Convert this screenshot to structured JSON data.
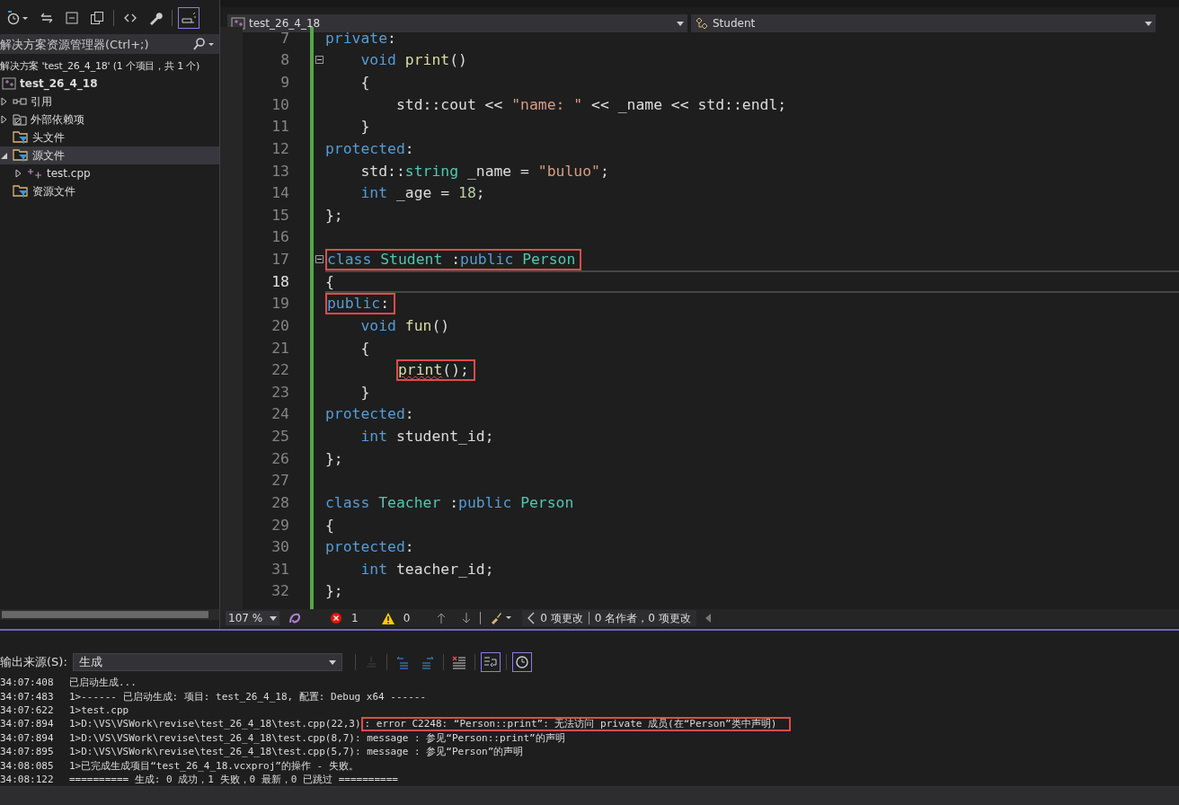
{
  "solution_explorer": {
    "toolbar": [
      {
        "kind": "history",
        "selected": false
      },
      {
        "kind": "sync",
        "selected": false
      },
      {
        "kind": "collapse",
        "selected": false
      },
      {
        "kind": "copy",
        "selected": false
      },
      {
        "kind": "code",
        "selected": false
      },
      {
        "kind": "properties",
        "selected": false
      },
      {
        "kind": "preview",
        "selected": true
      }
    ],
    "search_placeholder": "解决方案资源管理器(Ctrl+;)",
    "tree": [
      {
        "label": "解决方案 'test_26_4_18' (1 个项目，共 1 个)",
        "kind": "solution",
        "selected": false,
        "children": [
          {
            "label": "test_26_4_18",
            "kind": "project",
            "selected": false,
            "children": [
              {
                "label": "引用",
                "kind": "reference",
                "expanded": false,
                "selected": false
              },
              {
                "label": "外部依赖项",
                "kind": "external",
                "expanded": false,
                "selected": false
              },
              {
                "label": "头文件",
                "kind": "filter",
                "selected": false
              },
              {
                "label": "源文件",
                "kind": "filter",
                "expanded": true,
                "selected": true,
                "children": [
                  {
                    "label": "test.cpp",
                    "kind": "file",
                    "expanded": false,
                    "selected": false
                  }
                ]
              },
              {
                "label": "资源文件",
                "kind": "filter",
                "selected": false
              }
            ]
          }
        ]
      }
    ]
  },
  "editor": {
    "project_dropdown": "test_26_4_18",
    "scope_dropdown": "Student",
    "lines": [
      {
        "number": "7",
        "tokens": [
          {
            "text": "private",
            "kind": "keyword"
          },
          {
            "text": ":",
            "kind": "plain"
          }
        ]
      },
      {
        "number": "8",
        "foldable": true,
        "tokens": [
          {
            "text": "    void",
            "kind": "keyword"
          },
          {
            "text": " print",
            "kind": "function"
          },
          {
            "text": "()",
            "kind": "plain"
          }
        ]
      },
      {
        "number": "9",
        "tokens": [
          {
            "text": "    {",
            "kind": "plain"
          }
        ]
      },
      {
        "number": "10",
        "tokens": [
          {
            "text": "        std::cout << ",
            "kind": "plain"
          },
          {
            "text": "\"name: \"",
            "kind": "string"
          },
          {
            "text": " << _name << std::endl;",
            "kind": "plain"
          }
        ]
      },
      {
        "number": "11",
        "tokens": [
          {
            "text": "    }",
            "kind": "plain"
          }
        ]
      },
      {
        "number": "12",
        "tokens": [
          {
            "text": "protected",
            "kind": "keyword"
          },
          {
            "text": ":",
            "kind": "plain"
          }
        ]
      },
      {
        "number": "13",
        "tokens": [
          {
            "text": "    std::",
            "kind": "plain"
          },
          {
            "text": "string",
            "kind": "type"
          },
          {
            "text": " _name = ",
            "kind": "plain"
          },
          {
            "text": "\"buluo\"",
            "kind": "string"
          },
          {
            "text": ";",
            "kind": "plain"
          }
        ]
      },
      {
        "number": "14",
        "tokens": [
          {
            "text": "    int",
            "kind": "keyword"
          },
          {
            "text": " _age = ",
            "kind": "plain"
          },
          {
            "text": "18",
            "kind": "number"
          },
          {
            "text": ";",
            "kind": "plain"
          }
        ]
      },
      {
        "number": "15",
        "tokens": [
          {
            "text": "};",
            "kind": "plain"
          }
        ]
      },
      {
        "number": "16"
      },
      {
        "number": "17",
        "foldable": true,
        "tokens": [
          {
            "text": "class",
            "kind": "keyword",
            "boxed": true
          },
          {
            "text": " Student",
            "kind": "type",
            "boxed": true
          },
          {
            "text": " :",
            "kind": "plain",
            "boxed": true
          },
          {
            "text": "public",
            "kind": "keyword",
            "boxed": true
          },
          {
            "text": " Person",
            "kind": "type",
            "boxed": true
          }
        ]
      },
      {
        "number": "18",
        "current": true,
        "tokens": [
          {
            "text": "{",
            "kind": "plain"
          }
        ]
      },
      {
        "number": "19",
        "tokens": [
          {
            "text": "public",
            "kind": "keyword",
            "boxed": true
          },
          {
            "text": ":",
            "kind": "plain",
            "boxed": true
          }
        ]
      },
      {
        "number": "20",
        "tokens": [
          {
            "text": "    void",
            "kind": "keyword"
          },
          {
            "text": " fun",
            "kind": "function"
          },
          {
            "text": "()",
            "kind": "plain"
          }
        ]
      },
      {
        "number": "21",
        "tokens": [
          {
            "text": "    {",
            "kind": "plain"
          }
        ]
      },
      {
        "number": "22",
        "tokens": [
          {
            "text": "        print",
            "kind": "function",
            "boxed": true,
            "error": true
          },
          {
            "text": "();",
            "kind": "plain",
            "boxed": true
          }
        ]
      },
      {
        "number": "23",
        "tokens": [
          {
            "text": "    }",
            "kind": "plain"
          }
        ]
      },
      {
        "number": "24",
        "tokens": [
          {
            "text": "protected",
            "kind": "keyword"
          },
          {
            "text": ":",
            "kind": "plain"
          }
        ]
      },
      {
        "number": "25",
        "tokens": [
          {
            "text": "    int",
            "kind": "keyword"
          },
          {
            "text": " student_id;",
            "kind": "plain"
          }
        ]
      },
      {
        "number": "26",
        "tokens": [
          {
            "text": "};",
            "kind": "plain"
          }
        ]
      },
      {
        "number": "27"
      },
      {
        "number": "28",
        "tokens": [
          {
            "text": "class",
            "kind": "keyword"
          },
          {
            "text": " Teacher",
            "kind": "type"
          },
          {
            "text": " :",
            "kind": "plain"
          },
          {
            "text": "public",
            "kind": "keyword"
          },
          {
            "text": " Person",
            "kind": "type"
          }
        ]
      },
      {
        "number": "29",
        "tokens": [
          {
            "text": "{",
            "kind": "plain"
          }
        ]
      },
      {
        "number": "30",
        "tokens": [
          {
            "text": "protected",
            "kind": "keyword"
          },
          {
            "text": ":",
            "kind": "plain"
          }
        ]
      },
      {
        "number": "31",
        "tokens": [
          {
            "text": "    int",
            "kind": "keyword"
          },
          {
            "text": " teacher_id;",
            "kind": "plain"
          }
        ]
      },
      {
        "number": "32",
        "tokens": [
          {
            "text": "};",
            "kind": "plain"
          }
        ]
      }
    ],
    "status": {
      "zoom": "107 %",
      "errors": "1",
      "warnings": "0",
      "changes": "0 项更改",
      "authors": "0 名作者，0 项更改"
    }
  },
  "output": {
    "source_label": "输出来源(S):",
    "source_value": "生成",
    "toolbar": [
      {
        "kind": "goto",
        "disabled": true,
        "selected": false
      },
      {
        "kind": "previous",
        "disabled": false,
        "selected": false
      },
      {
        "kind": "next",
        "disabled": false,
        "selected": false
      },
      {
        "kind": "clear",
        "disabled": false,
        "selected": false
      },
      {
        "kind": "wrap",
        "disabled": false,
        "selected": true
      },
      {
        "kind": "timestamp",
        "disabled": false,
        "selected": true
      }
    ],
    "lines": [
      {
        "time": "34:07:408",
        "text": "已启动生成..."
      },
      {
        "time": "34:07:483",
        "text": "1>------ 已启动生成: 项目: test_26_4_18, 配置: Debug x64 ------"
      },
      {
        "time": "34:07:622",
        "text": "1>test.cpp"
      },
      {
        "time": "34:07:894",
        "text": "1>D:\\VS\\VSWork\\revise\\test_26_4_18\\test.cpp(22,3)",
        "boxed_text": ": error C2248: “Person::print”: 无法访问 private 成员(在“Person”类中声明)"
      },
      {
        "time": "34:07:894",
        "text": "1>D:\\VS\\VSWork\\revise\\test_26_4_18\\test.cpp(8,7): message : 参见“Person::print”的声明"
      },
      {
        "time": "34:07:895",
        "text": "1>D:\\VS\\VSWork\\revise\\test_26_4_18\\test.cpp(5,7): message : 参见“Person”的声明"
      },
      {
        "time": "34:08:085",
        "text": "1>已完成生成项目“test_26_4_18.vcxproj”的操作 - 失败。"
      },
      {
        "time": "34:08:122",
        "text": "========== 生成: 0 成功，1 失败，0 最新，0 已跳过 =========="
      }
    ]
  }
}
